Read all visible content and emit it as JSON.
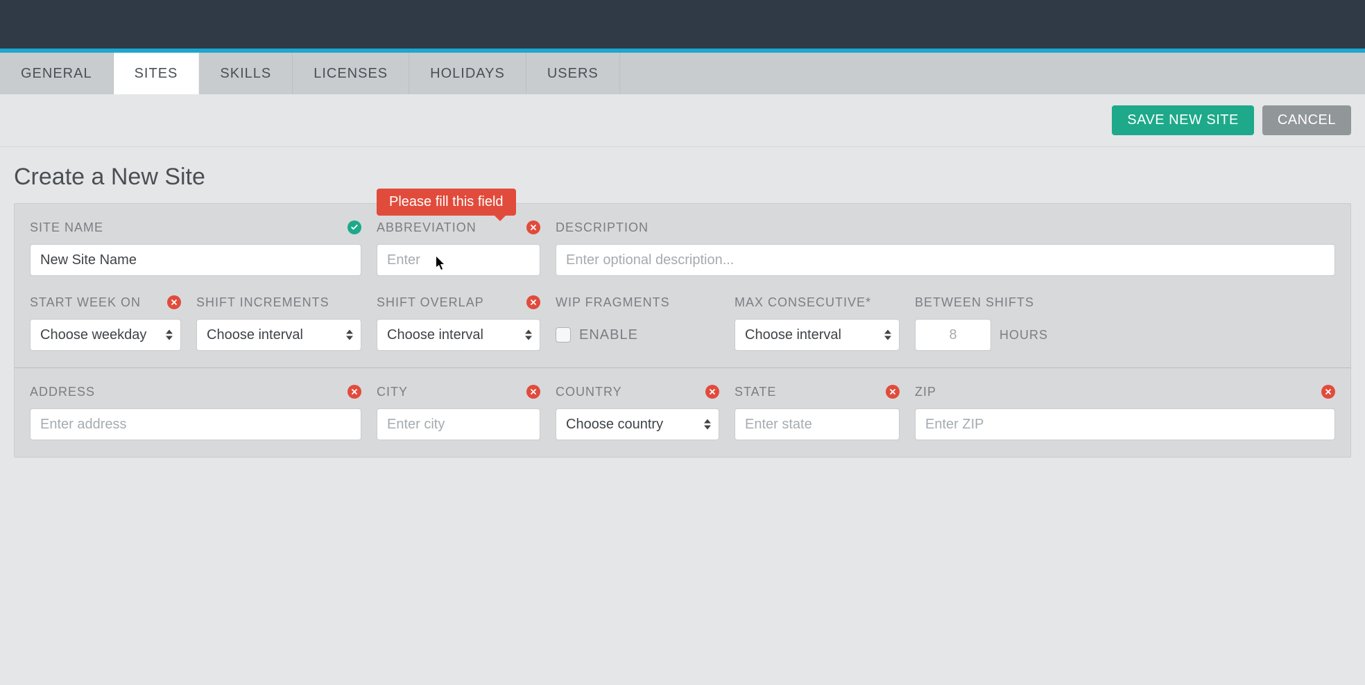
{
  "tabs": [
    "GENERAL",
    "SITES",
    "SKILLS",
    "LICENSES",
    "HOLIDAYS",
    "USERS"
  ],
  "activeTab": "SITES",
  "actions": {
    "save": "SAVE NEW SITE",
    "cancel": "CANCEL"
  },
  "pageTitle": "Create a New Site",
  "validationTooltip": "Please fill this field",
  "fields": {
    "siteName": {
      "label": "SITE NAME",
      "value": "New Site Name",
      "status": "ok"
    },
    "abbreviation": {
      "label": "ABBREVIATION",
      "placeholder": "Enter",
      "status": "error"
    },
    "description": {
      "label": "DESCRIPTION",
      "placeholder": "Enter optional description..."
    },
    "startWeek": {
      "label": "START WEEK ON",
      "selected": "Choose weekday",
      "status": "error"
    },
    "shiftIncrements": {
      "label": "SHIFT INCREMENTS",
      "selected": "Choose interval"
    },
    "shiftOverlap": {
      "label": "SHIFT OVERLAP",
      "selected": "Choose interval",
      "status": "error"
    },
    "wipFragments": {
      "label": "WIP FRAGMENTS",
      "checkboxLabel": "ENABLE"
    },
    "maxConsecutive": {
      "label": "MAX CONSECUTIVE*",
      "selected": "Choose interval"
    },
    "betweenShifts": {
      "label": "BETWEEN SHIFTS",
      "value": "8",
      "suffix": "HOURS"
    },
    "address": {
      "label": "ADDRESS",
      "placeholder": "Enter address",
      "status": "error"
    },
    "city": {
      "label": "CITY",
      "placeholder": "Enter city",
      "status": "error"
    },
    "country": {
      "label": "COUNTRY",
      "selected": "Choose country",
      "status": "error"
    },
    "state": {
      "label": "STATE",
      "placeholder": "Enter state",
      "status": "error"
    },
    "zip": {
      "label": "ZIP",
      "placeholder": "Enter ZIP",
      "status": "error"
    }
  },
  "colors": {
    "accent": "#1ca7d0",
    "primary": "#1da98a",
    "error": "#e14b3b"
  }
}
